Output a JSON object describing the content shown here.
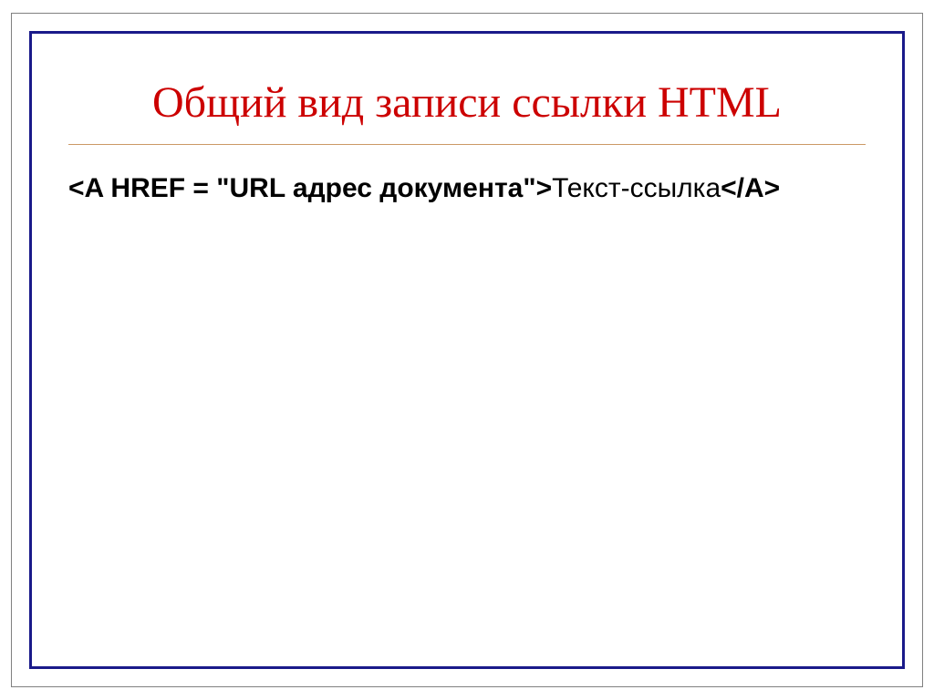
{
  "slide": {
    "title": "Общий вид записи ссылки HTML",
    "body": {
      "bold_open": "<A HREF = \"URL адрес документа\">",
      "plain_middle": "Текст-ссылка",
      "bold_close": "</A>"
    }
  }
}
